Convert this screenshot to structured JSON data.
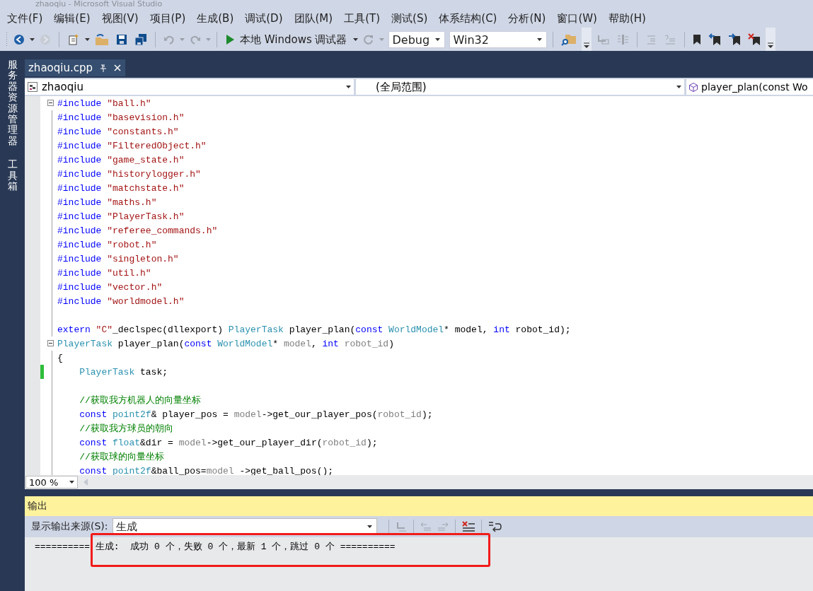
{
  "window": {
    "title": "zhaoqiu - Microsoft Visual Studio"
  },
  "menu": [
    "文件(F)",
    "编辑(E)",
    "视图(V)",
    "项目(P)",
    "生成(B)",
    "调试(D)",
    "团队(M)",
    "工具(T)",
    "测试(S)",
    "体系结构(C)",
    "分析(N)",
    "窗口(W)",
    "帮助(H)"
  ],
  "toolbar": {
    "items": [
      {
        "kind": "back",
        "disabled": false
      },
      {
        "kind": "caret",
        "disabled": false
      },
      {
        "kind": "forward",
        "disabled": true
      },
      {
        "kind": "sep"
      },
      {
        "kind": "new",
        "disabled": false
      },
      {
        "kind": "caret",
        "disabled": false
      },
      {
        "kind": "open",
        "disabled": false
      },
      {
        "kind": "save",
        "disabled": false
      },
      {
        "kind": "saveall",
        "disabled": false
      },
      {
        "kind": "sep"
      },
      {
        "kind": "undo",
        "disabled": true
      },
      {
        "kind": "caret",
        "disabled": true
      },
      {
        "kind": "redo",
        "disabled": true
      },
      {
        "kind": "caret",
        "disabled": true
      },
      {
        "kind": "sep"
      },
      {
        "kind": "start",
        "label": "本地 Windows 调试器"
      },
      {
        "kind": "caret",
        "disabled": false
      },
      {
        "kind": "refresh",
        "disabled": true
      },
      {
        "kind": "caret",
        "disabled": true
      },
      {
        "kind": "config",
        "value": "Debug"
      },
      {
        "kind": "platform",
        "value": "Win32"
      },
      {
        "kind": "sep"
      },
      {
        "kind": "find",
        "disabled": false
      },
      {
        "kind": "overflow"
      },
      {
        "kind": "indent",
        "disabled": true
      },
      {
        "kind": "outdent",
        "disabled": true
      },
      {
        "kind": "sep"
      },
      {
        "kind": "comment",
        "disabled": true
      },
      {
        "kind": "uncomment",
        "disabled": true
      },
      {
        "kind": "sep"
      },
      {
        "kind": "bookmark",
        "disabled": false
      },
      {
        "kind": "prevbookmark",
        "disabled": false
      },
      {
        "kind": "nextbookmark",
        "disabled": false
      },
      {
        "kind": "clearbookmark",
        "disabled": false
      },
      {
        "kind": "overflow"
      }
    ]
  },
  "side_panel": {
    "tabs": [
      "服务器资源管理器",
      "工具箱"
    ]
  },
  "editor": {
    "tabs": [
      {
        "label": "zhaoqiu.cpp",
        "selected": true
      }
    ],
    "nav": {
      "project": "zhaoqiu",
      "scope": "(全局范围)",
      "member": "player_plan(const Wo"
    },
    "lines": [
      {
        "fold": true,
        "tokens": [
          {
            "kind": "kw",
            "text": "#include "
          },
          {
            "kind": "str",
            "text": "\"ball.h\""
          }
        ]
      },
      {
        "tokens": [
          {
            "kind": "kw",
            "text": "#include "
          },
          {
            "kind": "str",
            "text": "\"basevision.h\""
          }
        ]
      },
      {
        "tokens": [
          {
            "kind": "kw",
            "text": "#include "
          },
          {
            "kind": "str",
            "text": "\"constants.h\""
          }
        ]
      },
      {
        "tokens": [
          {
            "kind": "kw",
            "text": "#include "
          },
          {
            "kind": "str",
            "text": "\"FilteredObject.h\""
          }
        ]
      },
      {
        "tokens": [
          {
            "kind": "kw",
            "text": "#include "
          },
          {
            "kind": "str",
            "text": "\"game_state.h\""
          }
        ]
      },
      {
        "tokens": [
          {
            "kind": "kw",
            "text": "#include "
          },
          {
            "kind": "str",
            "text": "\"historylogger.h\""
          }
        ]
      },
      {
        "tokens": [
          {
            "kind": "kw",
            "text": "#include "
          },
          {
            "kind": "str",
            "text": "\"matchstate.h\""
          }
        ]
      },
      {
        "tokens": [
          {
            "kind": "kw",
            "text": "#include "
          },
          {
            "kind": "str",
            "text": "\"maths.h\""
          }
        ]
      },
      {
        "tokens": [
          {
            "kind": "kw",
            "text": "#include "
          },
          {
            "kind": "str",
            "text": "\"PlayerTask.h\""
          }
        ]
      },
      {
        "tokens": [
          {
            "kind": "kw",
            "text": "#include "
          },
          {
            "kind": "str",
            "text": "\"referee_commands.h\""
          }
        ]
      },
      {
        "tokens": [
          {
            "kind": "kw",
            "text": "#include "
          },
          {
            "kind": "str",
            "text": "\"robot.h\""
          }
        ]
      },
      {
        "tokens": [
          {
            "kind": "kw",
            "text": "#include "
          },
          {
            "kind": "str",
            "text": "\"singleton.h\""
          }
        ]
      },
      {
        "tokens": [
          {
            "kind": "kw",
            "text": "#include "
          },
          {
            "kind": "str",
            "text": "\"util.h\""
          }
        ]
      },
      {
        "tokens": [
          {
            "kind": "kw",
            "text": "#include "
          },
          {
            "kind": "str",
            "text": "\"vector.h\""
          }
        ]
      },
      {
        "tokens": [
          {
            "kind": "kw",
            "text": "#include "
          },
          {
            "kind": "str",
            "text": "\"worldmodel.h\""
          }
        ]
      },
      {
        "changed": false
      },
      {
        "tokens": [
          {
            "kind": "kw",
            "text": "extern "
          },
          {
            "kind": "str",
            "text": "\"C\""
          },
          {
            "kind": "plain",
            "text": "_declspec(dllexport) "
          },
          {
            "kind": "type",
            "text": "PlayerTask"
          },
          {
            "kind": "plain",
            "text": " player_plan("
          },
          {
            "kind": "kw",
            "text": "const "
          },
          {
            "kind": "type",
            "text": "WorldModel"
          },
          {
            "kind": "plain",
            "text": "* model, "
          },
          {
            "kind": "kw",
            "text": "int"
          },
          {
            "kind": "plain",
            "text": " robot_id);"
          }
        ]
      },
      {
        "fold": true,
        "tokens": [
          {
            "kind": "type",
            "text": "PlayerTask"
          },
          {
            "kind": "plain",
            "text": " player_plan("
          },
          {
            "kind": "kw",
            "text": "const "
          },
          {
            "kind": "type",
            "text": "WorldModel"
          },
          {
            "kind": "plain",
            "text": "* "
          },
          {
            "kind": "param",
            "text": "model"
          },
          {
            "kind": "plain",
            "text": ", "
          },
          {
            "kind": "kw",
            "text": "int "
          },
          {
            "kind": "param",
            "text": "robot_id"
          },
          {
            "kind": "plain",
            "text": ")"
          }
        ]
      },
      {
        "tokens": [
          {
            "kind": "plain",
            "text": "{"
          }
        ]
      },
      {
        "changed": true,
        "tokens": [
          {
            "kind": "type",
            "text": "    PlayerTask"
          },
          {
            "kind": "plain",
            "text": " task;"
          }
        ]
      },
      {
        "changed": false
      },
      {
        "tokens": [
          {
            "kind": "cmt",
            "text": "    //获取我方机器人的向量坐标"
          }
        ]
      },
      {
        "tokens": [
          {
            "kind": "kw",
            "text": "    const "
          },
          {
            "kind": "type",
            "text": "point2f"
          },
          {
            "kind": "plain",
            "text": "& player_pos = "
          },
          {
            "kind": "param",
            "text": "model"
          },
          {
            "kind": "plain",
            "text": "->get_our_player_pos("
          },
          {
            "kind": "param",
            "text": "robot_id"
          },
          {
            "kind": "plain",
            "text": ");"
          }
        ]
      },
      {
        "tokens": [
          {
            "kind": "cmt",
            "text": "    //获取我方球员的朝向"
          }
        ]
      },
      {
        "tokens": [
          {
            "kind": "kw",
            "text": "    const "
          },
          {
            "kind": "type",
            "text": "float"
          },
          {
            "kind": "plain",
            "text": "&dir = "
          },
          {
            "kind": "param",
            "text": "model"
          },
          {
            "kind": "plain",
            "text": "->get_our_player_dir("
          },
          {
            "kind": "param",
            "text": "robot_id"
          },
          {
            "kind": "plain",
            "text": ");"
          }
        ]
      },
      {
        "tokens": [
          {
            "kind": "cmt",
            "text": "    //获取球的向量坐标"
          }
        ]
      },
      {
        "tokens": [
          {
            "kind": "kw",
            "text": "    const "
          },
          {
            "kind": "type",
            "text": "point2f"
          },
          {
            "kind": "plain",
            "text": "&ball_pos="
          },
          {
            "kind": "param",
            "text": "model"
          },
          {
            "kind": "plain",
            "text": " ->get_ball_pos();"
          }
        ]
      }
    ],
    "zoom": "100 %"
  },
  "output": {
    "title": "输出",
    "source_label": "显示输出来源(S):",
    "source": "生成",
    "tools": [
      {
        "kind": "goto",
        "disabled": true
      },
      {
        "kind": "prev",
        "disabled": true
      },
      {
        "kind": "next",
        "disabled": true
      },
      {
        "kind": "clear",
        "disabled": false
      },
      {
        "kind": "wrap",
        "disabled": false
      }
    ],
    "lines": [
      "========== 生成:  成功 0 个，失败 0 个，最新 1 个，跳过 0 个 =========="
    ]
  }
}
